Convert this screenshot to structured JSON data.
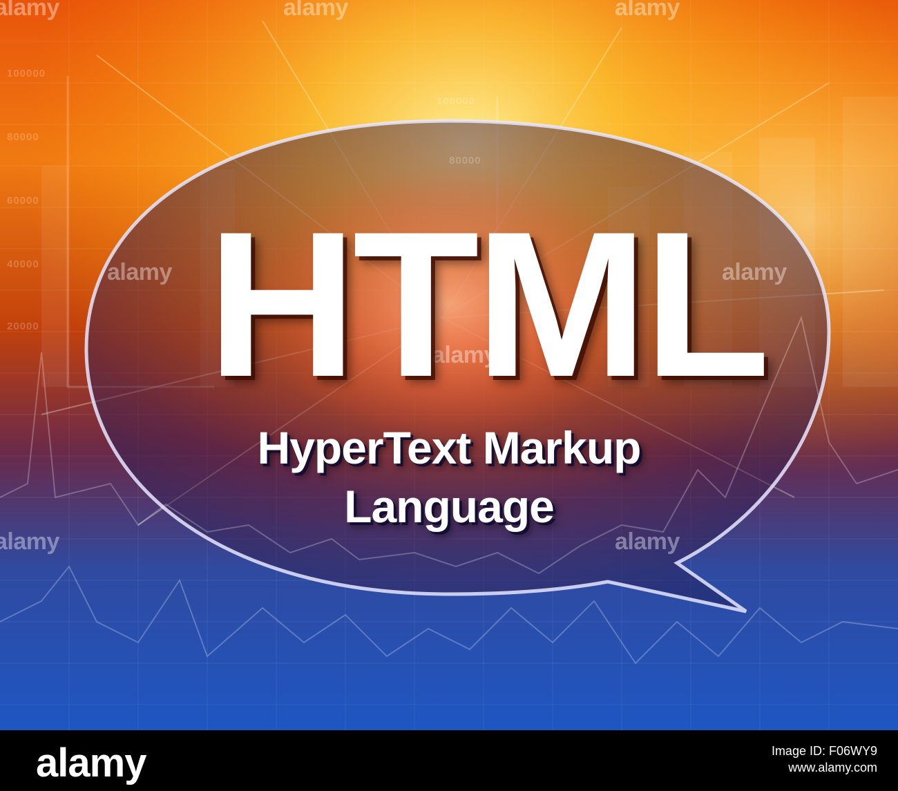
{
  "headline": "HTML",
  "subline_1": "HyperText Markup",
  "subline_2": "Language",
  "axis_ticks": [
    "100000",
    "80000",
    "60000",
    "40000",
    "20000",
    "100000",
    "80000"
  ],
  "watermark": "alamy",
  "footer": {
    "logo": "alamy",
    "image_id": "Image ID: F06WY9",
    "site": "www.alamy.com"
  },
  "colors": {
    "warm_top": "#ff6a00",
    "glow": "#ffd23a",
    "cool_bottom": "#1f4fb3",
    "footer_bg": "#000000"
  }
}
